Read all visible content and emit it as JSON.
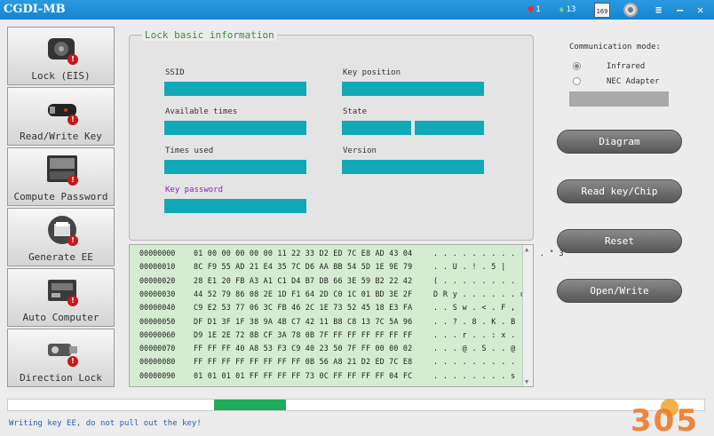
{
  "titlebar": {
    "app_title": "CGDI-MB",
    "hearts": "1",
    "gems": "13",
    "calendar_day": "169"
  },
  "sidebar": {
    "items": [
      {
        "label": "Lock (EIS)",
        "badge": "!",
        "icon": "ignition-lock-icon"
      },
      {
        "label": "Read/Write Key",
        "badge": "!",
        "icon": "car-key-icon"
      },
      {
        "label": "Compute Password",
        "badge": "!",
        "icon": "keyboard-device-icon"
      },
      {
        "label": "Generate EE",
        "badge": "!",
        "icon": "printer-icon"
      },
      {
        "label": "Auto Computer",
        "badge": "!",
        "icon": "ecu-module-icon"
      },
      {
        "label": "Direction Lock",
        "badge": "!",
        "icon": "steering-lock-icon"
      }
    ]
  },
  "lock_info": {
    "title": "Lock basic information",
    "ssid_label": "SSID",
    "key_position_label": "Key position",
    "available_times_label": "Available times",
    "state_label": "State",
    "times_used_label": "Times used",
    "version_label": "Version",
    "key_password_label": "Key password",
    "field_color": "#11a9b7"
  },
  "comm": {
    "title": "Communication mode:",
    "options": [
      "Infrared",
      "NEC Adapter"
    ],
    "selected": "Infrared"
  },
  "actions": {
    "diagram": "Diagram",
    "read_key": "Read key/Chip",
    "reset": "Reset",
    "open_write": "Open/Write"
  },
  "hex_rows": [
    {
      "addr": "00000000",
      "bytes": "01 00 00 00 00 00 11 22 33 D2 ED 7C E8 AD 43 04",
      "ascii": ". . . . . . . . . . . . \" 3"
    },
    {
      "addr": "00000010",
      "bytes": "8C F9 55 AD 21 E4 35 7C D6 AA BB 54 5D 1E 9E 79",
      "ascii": ". . U . ! . 5 |"
    },
    {
      "addr": "00000020",
      "bytes": "28 E1 20 FB A3 A1 C1 D4 B7 DB 66 3E 59 B2 22 42",
      "ascii": "( . . . . . . . . . ."
    },
    {
      "addr": "00000030",
      "bytes": "44 52 79 86 08 2E 1D F1 64 2D C0 1C 01 BD 3E 2F",
      "ascii": "D R y . . . . . . d"
    },
    {
      "addr": "00000040",
      "bytes": "C9 E2 53 77 06 3C FB 46 2C 1E 73 52 45 18 E3 FA",
      "ascii": ". . S w . < . F ,"
    },
    {
      "addr": "00000050",
      "bytes": "DF D1 3F 1F 38 9A 4B C7 42 11 B8 C8 13 7C 5A 96",
      "ascii": ". . ? . 8 . K . B"
    },
    {
      "addr": "00000060",
      "bytes": "D9 1E 2E 72 8B CF 3A 78 0B 7F FF FF FF FF FF FF",
      "ascii": ". . . r . . : x ."
    },
    {
      "addr": "00000070",
      "bytes": "FF FF FF 40 A8 53 F3 C9 40 23 50 7F FF 00 00 02",
      "ascii": ". . . @ . S . . @"
    },
    {
      "addr": "00000080",
      "bytes": "FF FF FF FF FF FF FF FF 0B 56 A8 21 D2 ED 7C E8",
      "ascii": ". . . . . . . . . ."
    },
    {
      "addr": "00000090",
      "bytes": "01 01 01 01 FF FF FF FF 73 0C FF FF FF FF 04 FC",
      "ascii": ". . . . . . . . s"
    }
  ],
  "progress": {
    "fill_start": 0.296,
    "fill_end": 0.399,
    "fill_color": "#1fae5a"
  },
  "status_text": "Writing key EE, do not pull out the key!",
  "watermark_text": "305"
}
